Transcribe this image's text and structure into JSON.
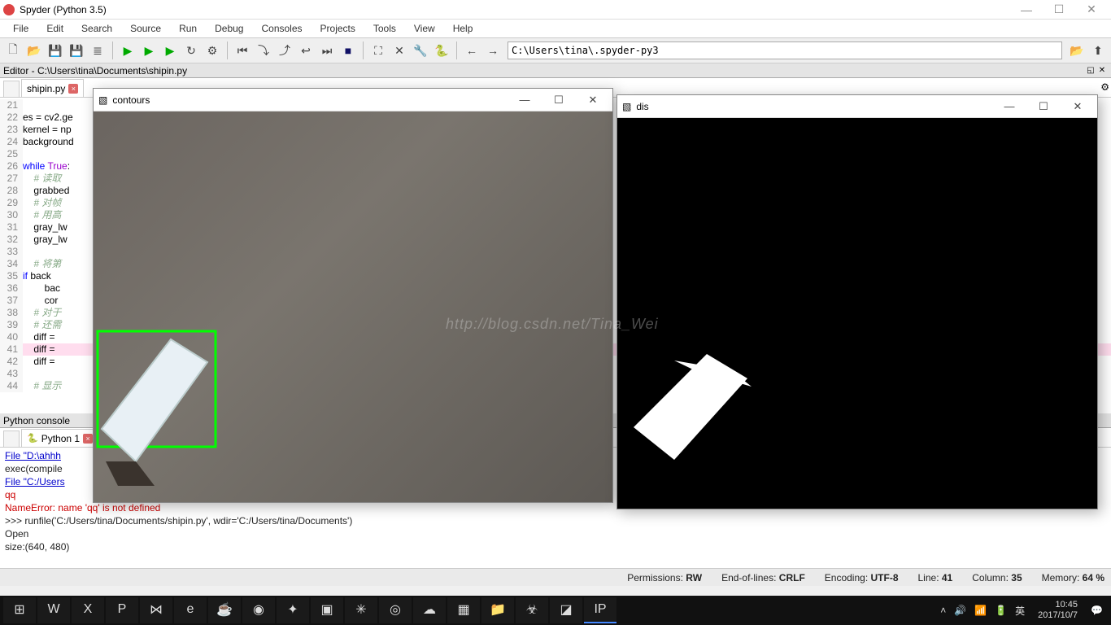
{
  "window": {
    "title": "Spyder (Python 3.5)"
  },
  "menu": [
    "File",
    "Edit",
    "Search",
    "Source",
    "Run",
    "Debug",
    "Consoles",
    "Projects",
    "Tools",
    "View",
    "Help"
  ],
  "toolbar": {
    "groups": [
      [
        "new-file-icon",
        "open-file-icon",
        "save-icon",
        "saveall-icon",
        "outline-icon"
      ],
      [
        "run-icon",
        "run-cell-icon",
        "run-cell-advance-icon",
        "rerun-icon",
        "run-config-icon"
      ],
      [
        "step-into-icon",
        "step-over-icon",
        "step-out-icon",
        "step-return-icon",
        "continue-icon",
        "stop-icon"
      ],
      [
        "maximize-icon",
        "fullscreen-icon",
        "preferences-icon",
        "python-icon"
      ],
      [
        "back-icon",
        "forward-icon"
      ]
    ],
    "glyphs": {
      "new-file-icon": "🗋",
      "open-file-icon": "📂",
      "save-icon": "💾",
      "saveall-icon": "💾",
      "outline-icon": "≣",
      "run-icon": "▶",
      "run-cell-icon": "▶",
      "run-cell-advance-icon": "▶",
      "rerun-icon": "↻",
      "run-config-icon": "⚙",
      "step-into-icon": "⏮",
      "step-over-icon": "⤵",
      "step-out-icon": "⤴",
      "step-return-icon": "↩",
      "continue-icon": "⏭",
      "stop-icon": "■",
      "maximize-icon": "⛶",
      "fullscreen-icon": "✕",
      "preferences-icon": "🔧",
      "python-icon": "🐍",
      "back-icon": "←",
      "forward-icon": "→",
      "parent-icon": "📂",
      "up-icon": "⬆"
    },
    "path": "C:\\Users\\tina\\.spyder-py3"
  },
  "editor": {
    "pane_title": "Editor - C:\\Users\\tina\\Documents\\shipin.py",
    "tab": "shipin.py",
    "lines": [
      {
        "n": 21,
        "t": ""
      },
      {
        "n": 22,
        "t": "es = cv2.ge"
      },
      {
        "n": 23,
        "t": "kernel = np"
      },
      {
        "n": 24,
        "t": "background "
      },
      {
        "n": 25,
        "t": ""
      },
      {
        "n": 26,
        "t": "",
        "pre": "while ",
        "kw": "True",
        "post": ":"
      },
      {
        "n": 27,
        "t": "    # 读取",
        "cm": true
      },
      {
        "n": 28,
        "t": "    grabbed"
      },
      {
        "n": 29,
        "t": "    # 对帧",
        "cm": true
      },
      {
        "n": 30,
        "t": "    # 用高",
        "cm": true
      },
      {
        "n": 31,
        "t": "    gray_lw"
      },
      {
        "n": 32,
        "t": "    gray_lw"
      },
      {
        "n": 33,
        "t": ""
      },
      {
        "n": 34,
        "t": "    # 将第",
        "cm": true
      },
      {
        "n": 35,
        "t": "    ",
        "pre": "if ",
        "post": "back"
      },
      {
        "n": 36,
        "t": "        bac"
      },
      {
        "n": 37,
        "t": "        cor"
      },
      {
        "n": 38,
        "t": "    # 对于",
        "cm": true
      },
      {
        "n": 39,
        "t": "    # 还需",
        "cm": true
      },
      {
        "n": 40,
        "t": "    diff ="
      },
      {
        "n": 41,
        "t": "    diff =",
        "hl": true
      },
      {
        "n": 42,
        "t": "    diff ="
      },
      {
        "n": 43,
        "t": ""
      },
      {
        "n": 44,
        "t": "    # 显示",
        "cm": true
      }
    ]
  },
  "console": {
    "pane_title": "Python console",
    "tab": "Python 1",
    "lines": [
      {
        "cls": "lnk",
        "t": "File \"D:\\ahhh"
      },
      {
        "cls": "",
        "t": "    exec(compile"
      },
      {
        "cls": "lnk",
        "t": "File \"C:/Users"
      },
      {
        "cls": "err",
        "t": "    qq"
      },
      {
        "cls": "err",
        "t": "NameError: name 'qq' is not defined"
      },
      {
        "cls": "",
        "t": ">>> runfile('C:/Users/tina/Documents/shipin.py', wdir='C:/Users/tina/Documents')"
      },
      {
        "cls": "",
        "t": "Open"
      },
      {
        "cls": "",
        "t": "size:(640, 480)"
      }
    ]
  },
  "status": {
    "permissions_label": "Permissions:",
    "permissions": "RW",
    "eol_label": "End-of-lines:",
    "eol": "CRLF",
    "encoding_label": "Encoding:",
    "encoding": "UTF-8",
    "line_label": "Line:",
    "line": "41",
    "column_label": "Column:",
    "column": "35",
    "memory_label": "Memory:",
    "memory": "64 %"
  },
  "taskbar": {
    "apps": [
      "start-icon",
      "word-icon",
      "excel-icon",
      "powerpoint-icon",
      "vs-icon",
      "ie-icon",
      "java-icon",
      "netease-icon",
      "bird-icon",
      "vm-icon",
      "atom-icon",
      "chrome-icon",
      "steam-icon",
      "pycharm-icon",
      "folder-icon",
      "bug-icon",
      "misc-icon",
      "ipy-icon"
    ],
    "glyphs": {
      "start-icon": "⊞",
      "word-icon": "W",
      "excel-icon": "X",
      "powerpoint-icon": "P",
      "vs-icon": "⋈",
      "ie-icon": "e",
      "java-icon": "☕",
      "netease-icon": "◉",
      "bird-icon": "✦",
      "vm-icon": "▣",
      "atom-icon": "✳",
      "chrome-icon": "◎",
      "steam-icon": "☁",
      "pycharm-icon": "▦",
      "folder-icon": "📁",
      "bug-icon": "☣",
      "misc-icon": "◪",
      "ipy-icon": "IP"
    },
    "tray": [
      "chevron-up-icon",
      "sound-icon",
      "network-icon",
      "battery-icon",
      "ime-icon"
    ],
    "tray_glyphs": {
      "chevron-up-icon": "˄",
      "sound-icon": "🔊",
      "network-icon": "📶",
      "battery-icon": "🔋",
      "ime-icon": "英"
    },
    "time": "10:45",
    "date": "2017/10/7",
    "action-center": "💬"
  },
  "float": {
    "contours": {
      "title": "contours"
    },
    "dis": {
      "title": "dis"
    }
  },
  "watermark": "http://blog.csdn.net/Tina_Wei"
}
